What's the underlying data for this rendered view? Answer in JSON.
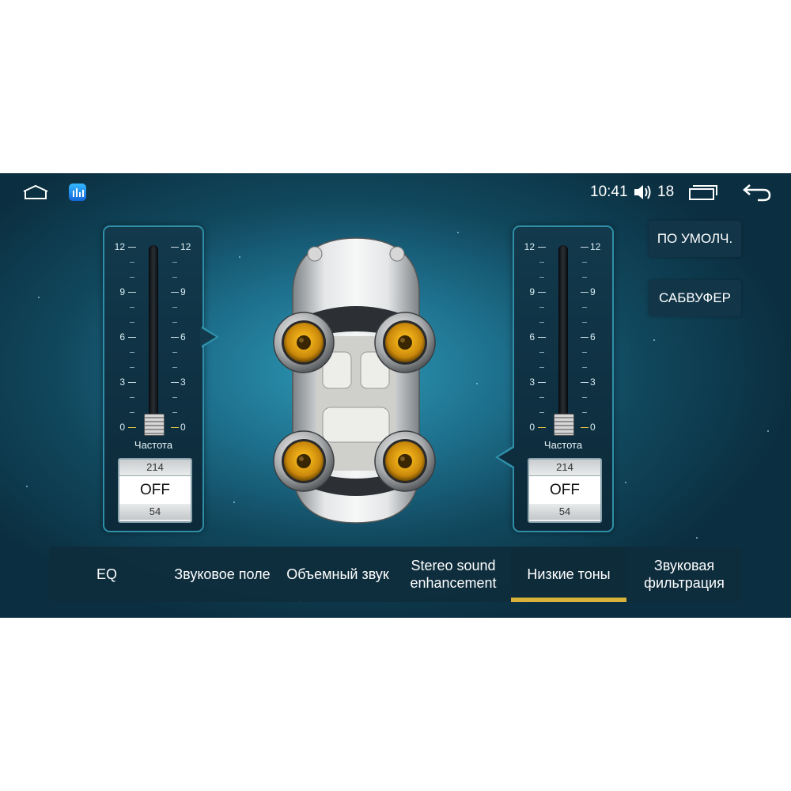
{
  "status": {
    "time": "10:41",
    "volume": "18"
  },
  "icons": {
    "home": "home-icon",
    "app": "equalizer-app-icon",
    "volume": "volume-icon",
    "recent": "recent-apps-icon",
    "back": "back-icon"
  },
  "sliders": {
    "ticks": [
      "12",
      "9",
      "6",
      "3",
      "0"
    ],
    "left": {
      "label": "Частота",
      "value": 0,
      "picker_prev": "214",
      "picker_value": "OFF",
      "picker_next": "54"
    },
    "right": {
      "label": "Частота",
      "value": 0,
      "picker_prev": "214",
      "picker_value": "OFF",
      "picker_next": "54"
    }
  },
  "buttons": {
    "default": "ПО УМОЛЧ.",
    "subwoofer": "САБВУФЕР"
  },
  "tabs": [
    {
      "label": "EQ",
      "active": false
    },
    {
      "label": "Звуковое поле",
      "active": false
    },
    {
      "label": "Объемный звук",
      "active": false
    },
    {
      "label": "Stereo sound enhancement",
      "active": false
    },
    {
      "label": "Низкие тоны",
      "active": true
    },
    {
      "label": "Звуковая фильтрация",
      "active": false
    }
  ],
  "colors": {
    "accent": "#d9b23a",
    "panel_border": "#2f8fa8",
    "background": "#1d6f8c"
  }
}
